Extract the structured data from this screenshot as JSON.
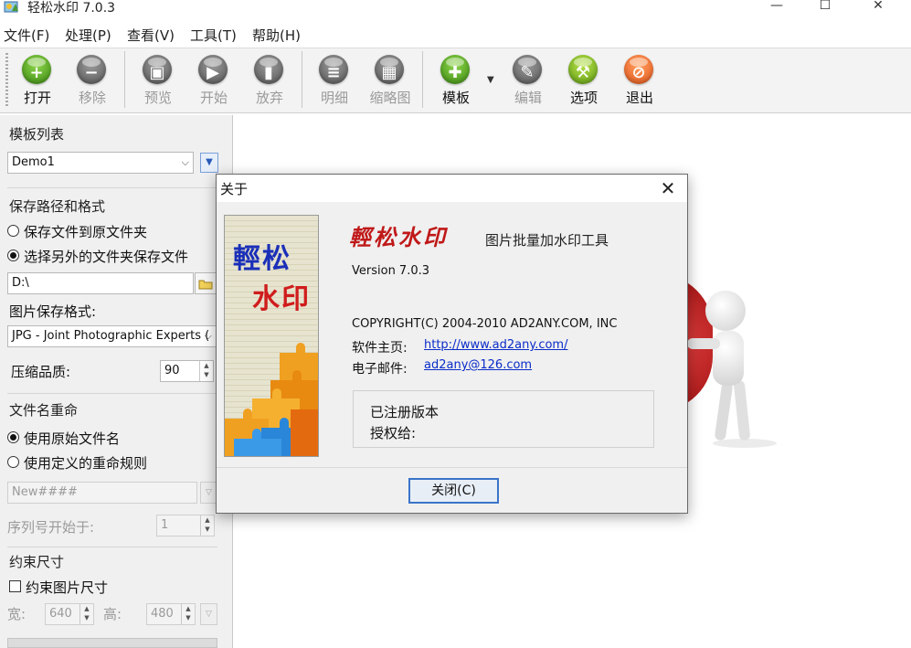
{
  "window": {
    "title": "轻松水印 7.0.3",
    "controls": {
      "minimize": "—",
      "maximize": "☐",
      "close": "✕"
    }
  },
  "menu": {
    "file": "文件(F)",
    "process": "处理(P)",
    "view": "查看(V)",
    "tools": "工具(T)",
    "help": "帮助(H)"
  },
  "toolbar": {
    "open": "打开",
    "remove": "移除",
    "preview": "预览",
    "start": "开始",
    "abort": "放弃",
    "details": "明细",
    "thumbnails": "缩略图",
    "template": "模板",
    "edit": "编辑",
    "options": "选项",
    "exit": "退出",
    "template_dropdown": "▼"
  },
  "left_panel": {
    "template_list": {
      "title": "模板列表",
      "selected": "Demo1"
    },
    "save_path": {
      "title": "保存路径和格式",
      "option_original": "保存文件到原文件夹",
      "option_other": "选择另外的文件夹保存文件",
      "path_value": "D:\\",
      "format_label": "图片保存格式:",
      "format_value": "JPG - Joint Photographic Experts (",
      "quality_label": "压缩品质:",
      "quality_value": "90"
    },
    "rename": {
      "title": "文件名重命",
      "option_original": "使用原始文件名",
      "option_custom": "使用定义的重命规则",
      "pattern_value": "New####",
      "seq_label": "序列号开始于:",
      "seq_value": "1"
    },
    "constrain": {
      "title": "约束尺寸",
      "checkbox_label": "约束图片尺寸",
      "width_label": "宽:",
      "width_value": "640",
      "height_label": "高:",
      "height_value": "480"
    }
  },
  "about_dialog": {
    "title": "关于",
    "close_x": "✕",
    "logo_line1": "輕松",
    "logo_line2": "水印",
    "brand_title": "輕松水印",
    "brand_subtitle": "图片批量加水印工具",
    "version": "Version  7.0.3",
    "copyright": "COPYRIGHT(C) 2004-2010 AD2ANY.COM, INC",
    "homepage_label": "软件主页:",
    "homepage_url": "http://www.ad2any.com/",
    "email_label": "电子邮件:",
    "email": "ad2any@126.com",
    "reg_status": "已注册版本",
    "licensed_to": "授权给:",
    "close_button": "关闭(C)"
  },
  "colors": {
    "accent_blue": "#3a74c8",
    "link": "#0a2cc8",
    "brand_red": "#c01818",
    "logo_blue": "#1a2fb8"
  }
}
